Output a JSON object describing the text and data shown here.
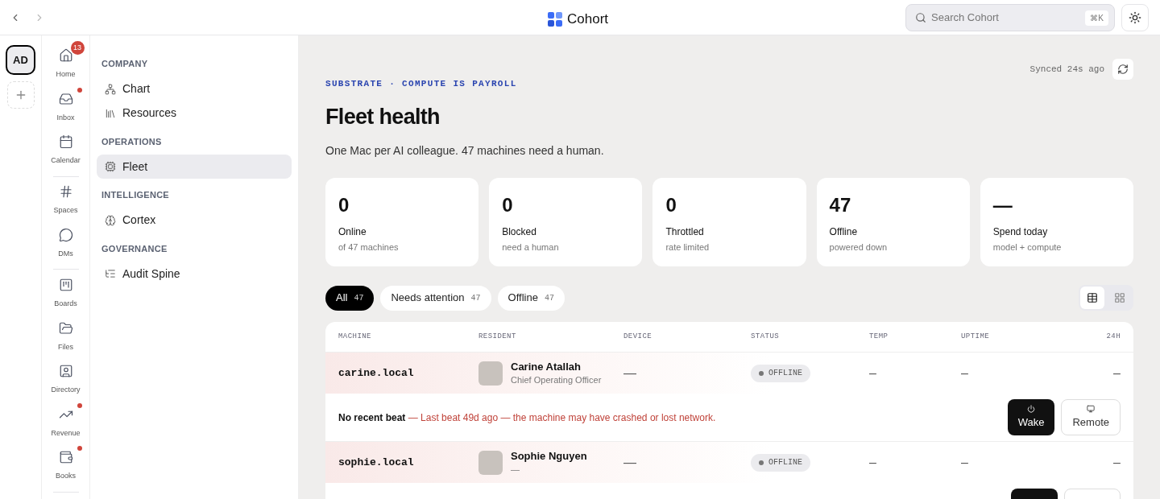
{
  "topbar": {
    "brand": "Cohort",
    "search": {
      "placeholder": "Search Cohort",
      "shortcut": "⌘K"
    }
  },
  "workspaces": [
    {
      "initials": "AD",
      "selected": true
    }
  ],
  "rail": [
    {
      "kind": "home",
      "label": "Home",
      "badge": "13",
      "dot": false
    },
    {
      "kind": "inbox",
      "label": "Inbox",
      "dot": true
    },
    {
      "kind": "calendar",
      "label": "Calendar",
      "dot": false,
      "divider": true
    },
    {
      "kind": "spaces",
      "label": "Spaces",
      "dot": false
    },
    {
      "kind": "dms",
      "label": "DMs",
      "dot": false,
      "divider": true
    },
    {
      "kind": "boards",
      "label": "Boards",
      "dot": false
    },
    {
      "kind": "files",
      "label": "Files",
      "dot": false
    },
    {
      "kind": "directory",
      "label": "Directory",
      "dot": false
    },
    {
      "kind": "revenue",
      "label": "Revenue",
      "dot": true
    },
    {
      "kind": "books",
      "label": "Books",
      "dot": true,
      "divider": true
    }
  ],
  "sidebar": [
    {
      "heading": "COMPANY",
      "items": [
        {
          "kind": "chart",
          "label": "Chart",
          "selected": false
        },
        {
          "kind": "resources",
          "label": "Resources",
          "selected": false
        }
      ]
    },
    {
      "heading": "OPERATIONS",
      "items": [
        {
          "kind": "fleet",
          "label": "Fleet",
          "selected": true
        }
      ]
    },
    {
      "heading": "INTELLIGENCE",
      "items": [
        {
          "kind": "cortex",
          "label": "Cortex",
          "selected": false
        }
      ]
    },
    {
      "heading": "GOVERNANCE",
      "items": [
        {
          "kind": "audit",
          "label": "Audit Spine",
          "selected": false
        }
      ]
    }
  ],
  "sync": "Synced 24s ago",
  "eyebrow": "SUBSTRATE · COMPUTE IS PAYROLL",
  "title": "Fleet health",
  "subtitle": "One Mac per AI colleague. 47 machines need a human.",
  "stats": [
    {
      "value": "0",
      "label": "Online",
      "note": "of 47 machines"
    },
    {
      "value": "0",
      "label": "Blocked",
      "note": "need a human"
    },
    {
      "value": "0",
      "label": "Throttled",
      "note": "rate limited"
    },
    {
      "value": "47",
      "label": "Offline",
      "note": "powered down"
    },
    {
      "value": "—",
      "label": "Spend today",
      "note": "model + compute"
    }
  ],
  "filters": [
    {
      "label": "All",
      "count": "47",
      "selected": true
    },
    {
      "label": "Needs attention",
      "count": "47",
      "selected": false
    },
    {
      "label": "Offline",
      "count": "47",
      "selected": false
    }
  ],
  "view": [
    {
      "kind": "table",
      "selected": true
    },
    {
      "kind": "grid",
      "selected": false
    }
  ],
  "table": {
    "columns": [
      "MACHINE",
      "RESIDENT",
      "DEVICE",
      "STATUS",
      "TEMP",
      "UPTIME",
      "24H"
    ],
    "rows": [
      {
        "machine": "carine.local",
        "name": "Carine Atallah",
        "role": "Chief Operating Officer",
        "device": "—",
        "status": "OFFLINE",
        "temp": "–",
        "uptime": "–",
        "h24": "–",
        "alert_title": "No recent beat",
        "alert": "— Last beat 49d ago — the machine may have crashed or lost network.",
        "actions": [
          {
            "kind": "wake",
            "label": "Wake"
          },
          {
            "kind": "remote",
            "label": "Remote"
          }
        ]
      },
      {
        "machine": "sophie.local",
        "name": "Sophie Nguyen",
        "role": "—",
        "device": "—",
        "status": "OFFLINE",
        "temp": "–",
        "uptime": "–",
        "h24": "–",
        "actions": [
          {
            "kind": "wake"
          },
          {
            "kind": "remote"
          }
        ]
      }
    ]
  }
}
